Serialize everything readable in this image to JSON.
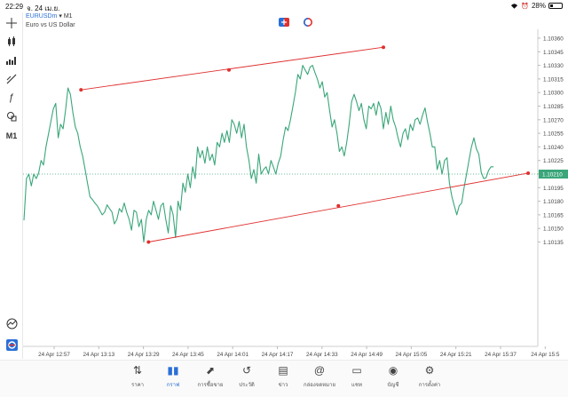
{
  "status": {
    "time": "22:29",
    "date": "จ. 24 เม.ย.",
    "battery": "28%"
  },
  "symbol": {
    "name": "EURUSDm",
    "timeframe": "M1",
    "description": "Euro vs US Dollar"
  },
  "left_toolbar": [
    {
      "icon": "crosshair-icon",
      "glyph": "+"
    },
    {
      "icon": "candles-icon",
      "glyph": ""
    },
    {
      "icon": "bar-chart-icon",
      "glyph": ""
    },
    {
      "icon": "line-tool-icon",
      "glyph": ""
    },
    {
      "icon": "function-icon",
      "glyph": "ƒ"
    },
    {
      "icon": "shapes-icon",
      "glyph": ""
    },
    {
      "icon": "timeframe-label",
      "glyph": "M1"
    }
  ],
  "chart_data": {
    "type": "line",
    "title": "",
    "xlabel": "",
    "ylabel": "",
    "line_color": "#3aa67a",
    "trendline_color": "#e03030",
    "ylim": [
      1.10125,
      1.10365
    ],
    "yticks": [
      "1.10360",
      "1.10345",
      "1.10330",
      "1.10315",
      "1.10300",
      "1.10285",
      "1.10270",
      "1.10255",
      "1.10240",
      "1.10225",
      "1.10210",
      "1.10195",
      "1.10180",
      "1.10165",
      "1.10150",
      "1.10135"
    ],
    "xticks": [
      "24 Apr 12:57",
      "24 Apr 13:13",
      "24 Apr 13:29",
      "24 Apr 13:45",
      "24 Apr 14:01",
      "24 Apr 14:17",
      "24 Apr 14:33",
      "24 Apr 14:49",
      "24 Apr 15:05",
      "24 Apr 15:21",
      "24 Apr 15:37",
      "24 Apr 15:5"
    ],
    "current_price": "1.10210",
    "series": [
      {
        "values": [
          1.10159,
          1.10205,
          1.1021,
          1.10197,
          1.1021,
          1.10205,
          1.10211,
          1.10225,
          1.1022,
          1.1024,
          1.10254,
          1.10268,
          1.10282,
          1.10288,
          1.1025,
          1.10265,
          1.1026,
          1.1028,
          1.10305,
          1.10298,
          1.10278,
          1.10262,
          1.10255,
          1.1024,
          1.1023,
          1.10215,
          1.102,
          1.10185,
          1.10182,
          1.10178,
          1.10175,
          1.1017,
          1.10165,
          1.10168,
          1.10176,
          1.10172,
          1.10168,
          1.10155,
          1.1016,
          1.10172,
          1.10168,
          1.10178,
          1.10168,
          1.1016,
          1.10148,
          1.1017,
          1.10168,
          1.10152,
          1.1016,
          1.10135,
          1.1016,
          1.1017,
          1.10165,
          1.1018,
          1.1017,
          1.1016,
          1.10175,
          1.10178,
          1.1016,
          1.10145,
          1.10175,
          1.10165,
          1.1014,
          1.1018,
          1.1017,
          1.102,
          1.1019,
          1.1021,
          1.10195,
          1.10218,
          1.10205,
          1.1024,
          1.10228,
          1.10236,
          1.10222,
          1.1024,
          1.10225,
          1.10232,
          1.1022,
          1.10245,
          1.1024,
          1.10255,
          1.10245,
          1.10258,
          1.10245,
          1.1027,
          1.10265,
          1.10255,
          1.10268,
          1.1025,
          1.10265,
          1.1024,
          1.10225,
          1.10205,
          1.10215,
          1.102,
          1.10232,
          1.1021,
          1.10215,
          1.10218,
          1.1021,
          1.10225,
          1.10218,
          1.1021,
          1.10222,
          1.1023,
          1.10248,
          1.10262,
          1.10258,
          1.1027,
          1.10285,
          1.103,
          1.1032,
          1.10315,
          1.1033,
          1.10325,
          1.1032,
          1.10328,
          1.1033,
          1.10322,
          1.10315,
          1.10305,
          1.10312,
          1.10295,
          1.103,
          1.1028,
          1.10262,
          1.1027,
          1.10255,
          1.10235,
          1.1024,
          1.1023,
          1.10245,
          1.10265,
          1.1029,
          1.10298,
          1.1029,
          1.1028,
          1.10288,
          1.1027,
          1.1026,
          1.10285,
          1.10282,
          1.10288,
          1.10275,
          1.1029,
          1.10282,
          1.1026,
          1.10278,
          1.10265,
          1.10285,
          1.1027,
          1.10262,
          1.1025,
          1.1024,
          1.10255,
          1.1026,
          1.10248,
          1.10265,
          1.10258,
          1.1027,
          1.10272,
          1.10265,
          1.10275,
          1.10283,
          1.10268,
          1.10255,
          1.1024,
          1.1024,
          1.10215,
          1.10225,
          1.1021,
          1.10225,
          1.10228,
          1.102,
          1.10185,
          1.10175,
          1.10165,
          1.10175,
          1.10178,
          1.10195,
          1.1021,
          1.10225,
          1.1024,
          1.1025,
          1.10238,
          1.10232,
          1.10212,
          1.10205,
          1.10206,
          1.10214,
          1.10218,
          1.10218
        ]
      }
    ],
    "trendlines": [
      {
        "points": [
          [
            0.1125,
            1.10303
          ],
          [
            0.7,
            1.1035
          ]
        ]
      },
      {
        "points": [
          [
            0.2437,
            1.10135
          ],
          [
            0.9812,
            1.10211
          ]
        ]
      }
    ],
    "trendline_mid_markers": [
      [
        0.4,
        1.10325
      ],
      [
        0.6125,
        1.10175
      ]
    ]
  },
  "nav": [
    {
      "icon": "quotes-icon",
      "label": "ราคา",
      "glyph": "⇅"
    },
    {
      "icon": "chart-icon",
      "label": "กราฟ",
      "glyph": "▮▮",
      "active": true
    },
    {
      "icon": "trade-icon",
      "label": "การซื้อขาย",
      "glyph": "⬈"
    },
    {
      "icon": "history-icon",
      "label": "ประวัติ",
      "glyph": "↺"
    },
    {
      "icon": "news-icon",
      "label": "ข่าว",
      "glyph": "▤"
    },
    {
      "icon": "mailbox-icon",
      "label": "กล่องจดหมาย",
      "glyph": "@"
    },
    {
      "icon": "chat-icon",
      "label": "แชท",
      "glyph": "▭"
    },
    {
      "icon": "account-icon",
      "label": "บัญชี",
      "glyph": "◉"
    },
    {
      "icon": "settings-icon",
      "label": "การตั้งค่า",
      "glyph": "⚙"
    }
  ]
}
